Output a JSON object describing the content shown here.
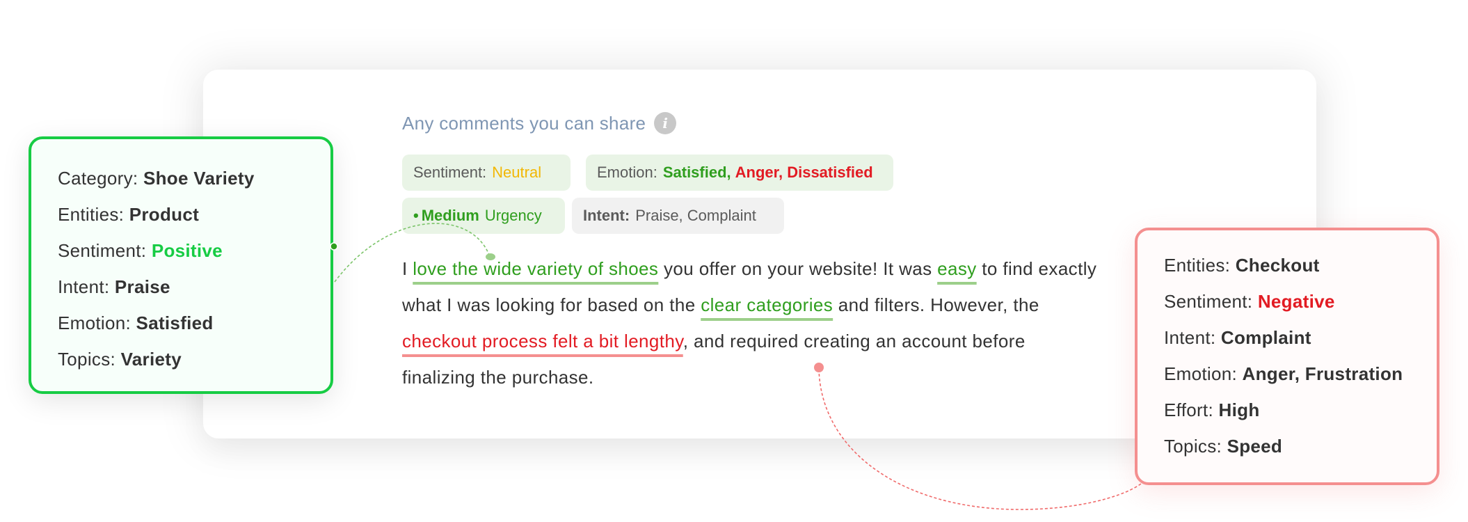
{
  "question": {
    "title": "Any comments you can share",
    "info_icon": "info-icon"
  },
  "chips": {
    "sentiment": {
      "label": "Sentiment:",
      "value": "Neutral"
    },
    "emotion": {
      "label": "Emotion:",
      "values_positive": "Satisfied,",
      "values_negative": "Anger, Dissatisfied"
    },
    "urgency": {
      "bullet": "•",
      "level": "Medium",
      "label": "Urgency"
    },
    "intent": {
      "label": "Intent:",
      "value": "Praise, Complaint"
    }
  },
  "comment": {
    "segments": [
      {
        "text": "I ",
        "type": "plain"
      },
      {
        "text": "love the wide variety of shoes",
        "type": "positive"
      },
      {
        "text": " you offer on your website!  It was ",
        "type": "plain"
      },
      {
        "text": "easy",
        "type": "positive"
      },
      {
        "text": " to find exactly what I was looking for based on the ",
        "type": "plain"
      },
      {
        "text": "clear categories",
        "type": "positive"
      },
      {
        "text": " and filters. However, the ",
        "type": "plain"
      },
      {
        "text": "checkout process felt a bit lengthy",
        "type": "negative"
      },
      {
        "text": ", and required creating an account before finalizing the purchase.",
        "type": "plain"
      }
    ]
  },
  "positive_panel": {
    "rows": [
      {
        "label": "Category:",
        "value": "Shoe Variety"
      },
      {
        "label": "Entities:",
        "value": "Product"
      },
      {
        "label": "Sentiment:",
        "value": "Positive"
      },
      {
        "label": "Intent:",
        "value": "Praise"
      },
      {
        "label": "Emotion:",
        "value": "Satisfied"
      },
      {
        "label": "Topics:",
        "value": "Variety"
      }
    ]
  },
  "negative_panel": {
    "rows": [
      {
        "label": "Entities:",
        "value": "Checkout"
      },
      {
        "label": "Sentiment:",
        "value": "Negative"
      },
      {
        "label": "Intent:",
        "value": "Complaint"
      },
      {
        "label": "Emotion:",
        "value": "Anger, Frustration"
      },
      {
        "label": "Effort:",
        "value": "High"
      },
      {
        "label": "Topics:",
        "value": "Speed"
      }
    ]
  },
  "colors": {
    "positive": "#17cc44",
    "positive_text": "#2f9e1e",
    "negative": "#e21b23",
    "negative_border": "#f48f8f",
    "neutral": "#f2b705",
    "title": "#7f96b3"
  }
}
